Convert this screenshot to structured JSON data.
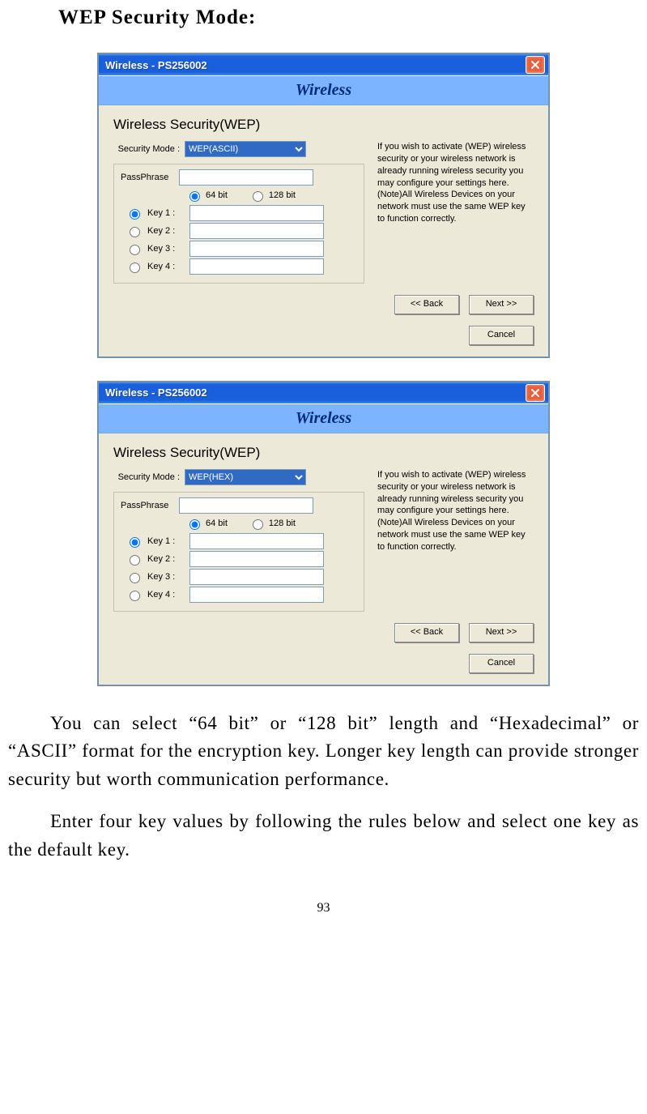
{
  "heading": "WEP Security Mode:",
  "dialog": {
    "window_title": "Wireless - PS256002",
    "banner": "Wireless",
    "section_title": "Wireless Security(WEP)",
    "security_mode_label": "Security Mode :",
    "passphrase_label": "PassPhrase",
    "bits": {
      "opt64": "64 bit",
      "opt128": "128 bit"
    },
    "keys": {
      "k1": "Key 1 :",
      "k2": "Key 2 :",
      "k3": "Key 3 :",
      "k4": "Key 4 :"
    },
    "help_text": "If you wish to activate (WEP) wireless security or your wireless network is already running wireless security you may configure your settings here. (Note)All Wireless Devices on your network must use the same WEP key to function correctly.",
    "buttons": {
      "back": "<< Back",
      "next": "Next >>",
      "cancel": "Cancel"
    }
  },
  "modes": {
    "ascii": "WEP(ASCII)",
    "hex": "WEP(HEX)"
  },
  "para1": "You can select “64 bit” or “128 bit” length and “Hexadecimal” or “ASCII” format for the encryption key. Longer key length can provide stronger security but worth communication performance.",
  "para2": "Enter four key values by following the rules below and select one key as the default key.",
  "page_number": "93"
}
